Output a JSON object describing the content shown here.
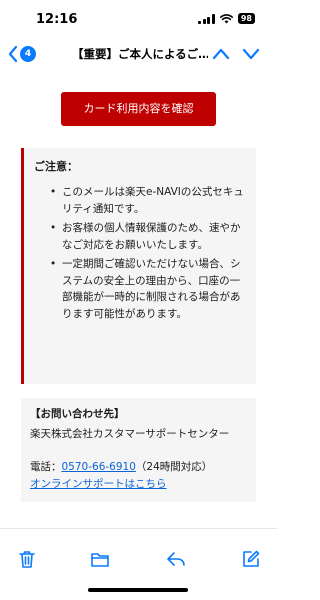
{
  "status_bar": {
    "time": "12:16",
    "battery": "98"
  },
  "nav": {
    "back_badge": "4",
    "title": "【重要】ご本人によるご…"
  },
  "email": {
    "card_button_label": "カード利用内容を確認",
    "notice": {
      "title": "ご注意：",
      "items": [
        "このメールは楽天e-NAVIの公式セキュリティ通知です。",
        "お客様の個人情報保護のため、速やかなご対応をお願いいたします。",
        "一定期間ご確認いただけない場合、システムの安全上の理由から、口座の一部機能が一時的に制限される場合があります可能性があります。"
      ]
    },
    "contact": {
      "title": "【お問い合わせ先】",
      "company": "楽天株式会社カスタマーサポートセンター",
      "phone_label": "電話：",
      "phone_number": "0570-66-6910",
      "phone_hours": "（24時間対応）",
      "link_label": "オンラインサポートはこちら"
    }
  },
  "colors": {
    "accent": "#0a7aff",
    "brand_red": "#bf0000",
    "link": "#0a64d8",
    "box_bg": "#f5f5f5"
  },
  "toolbar": {
    "icons": [
      "trash-icon",
      "folder-icon",
      "reply-icon",
      "compose-icon"
    ]
  }
}
